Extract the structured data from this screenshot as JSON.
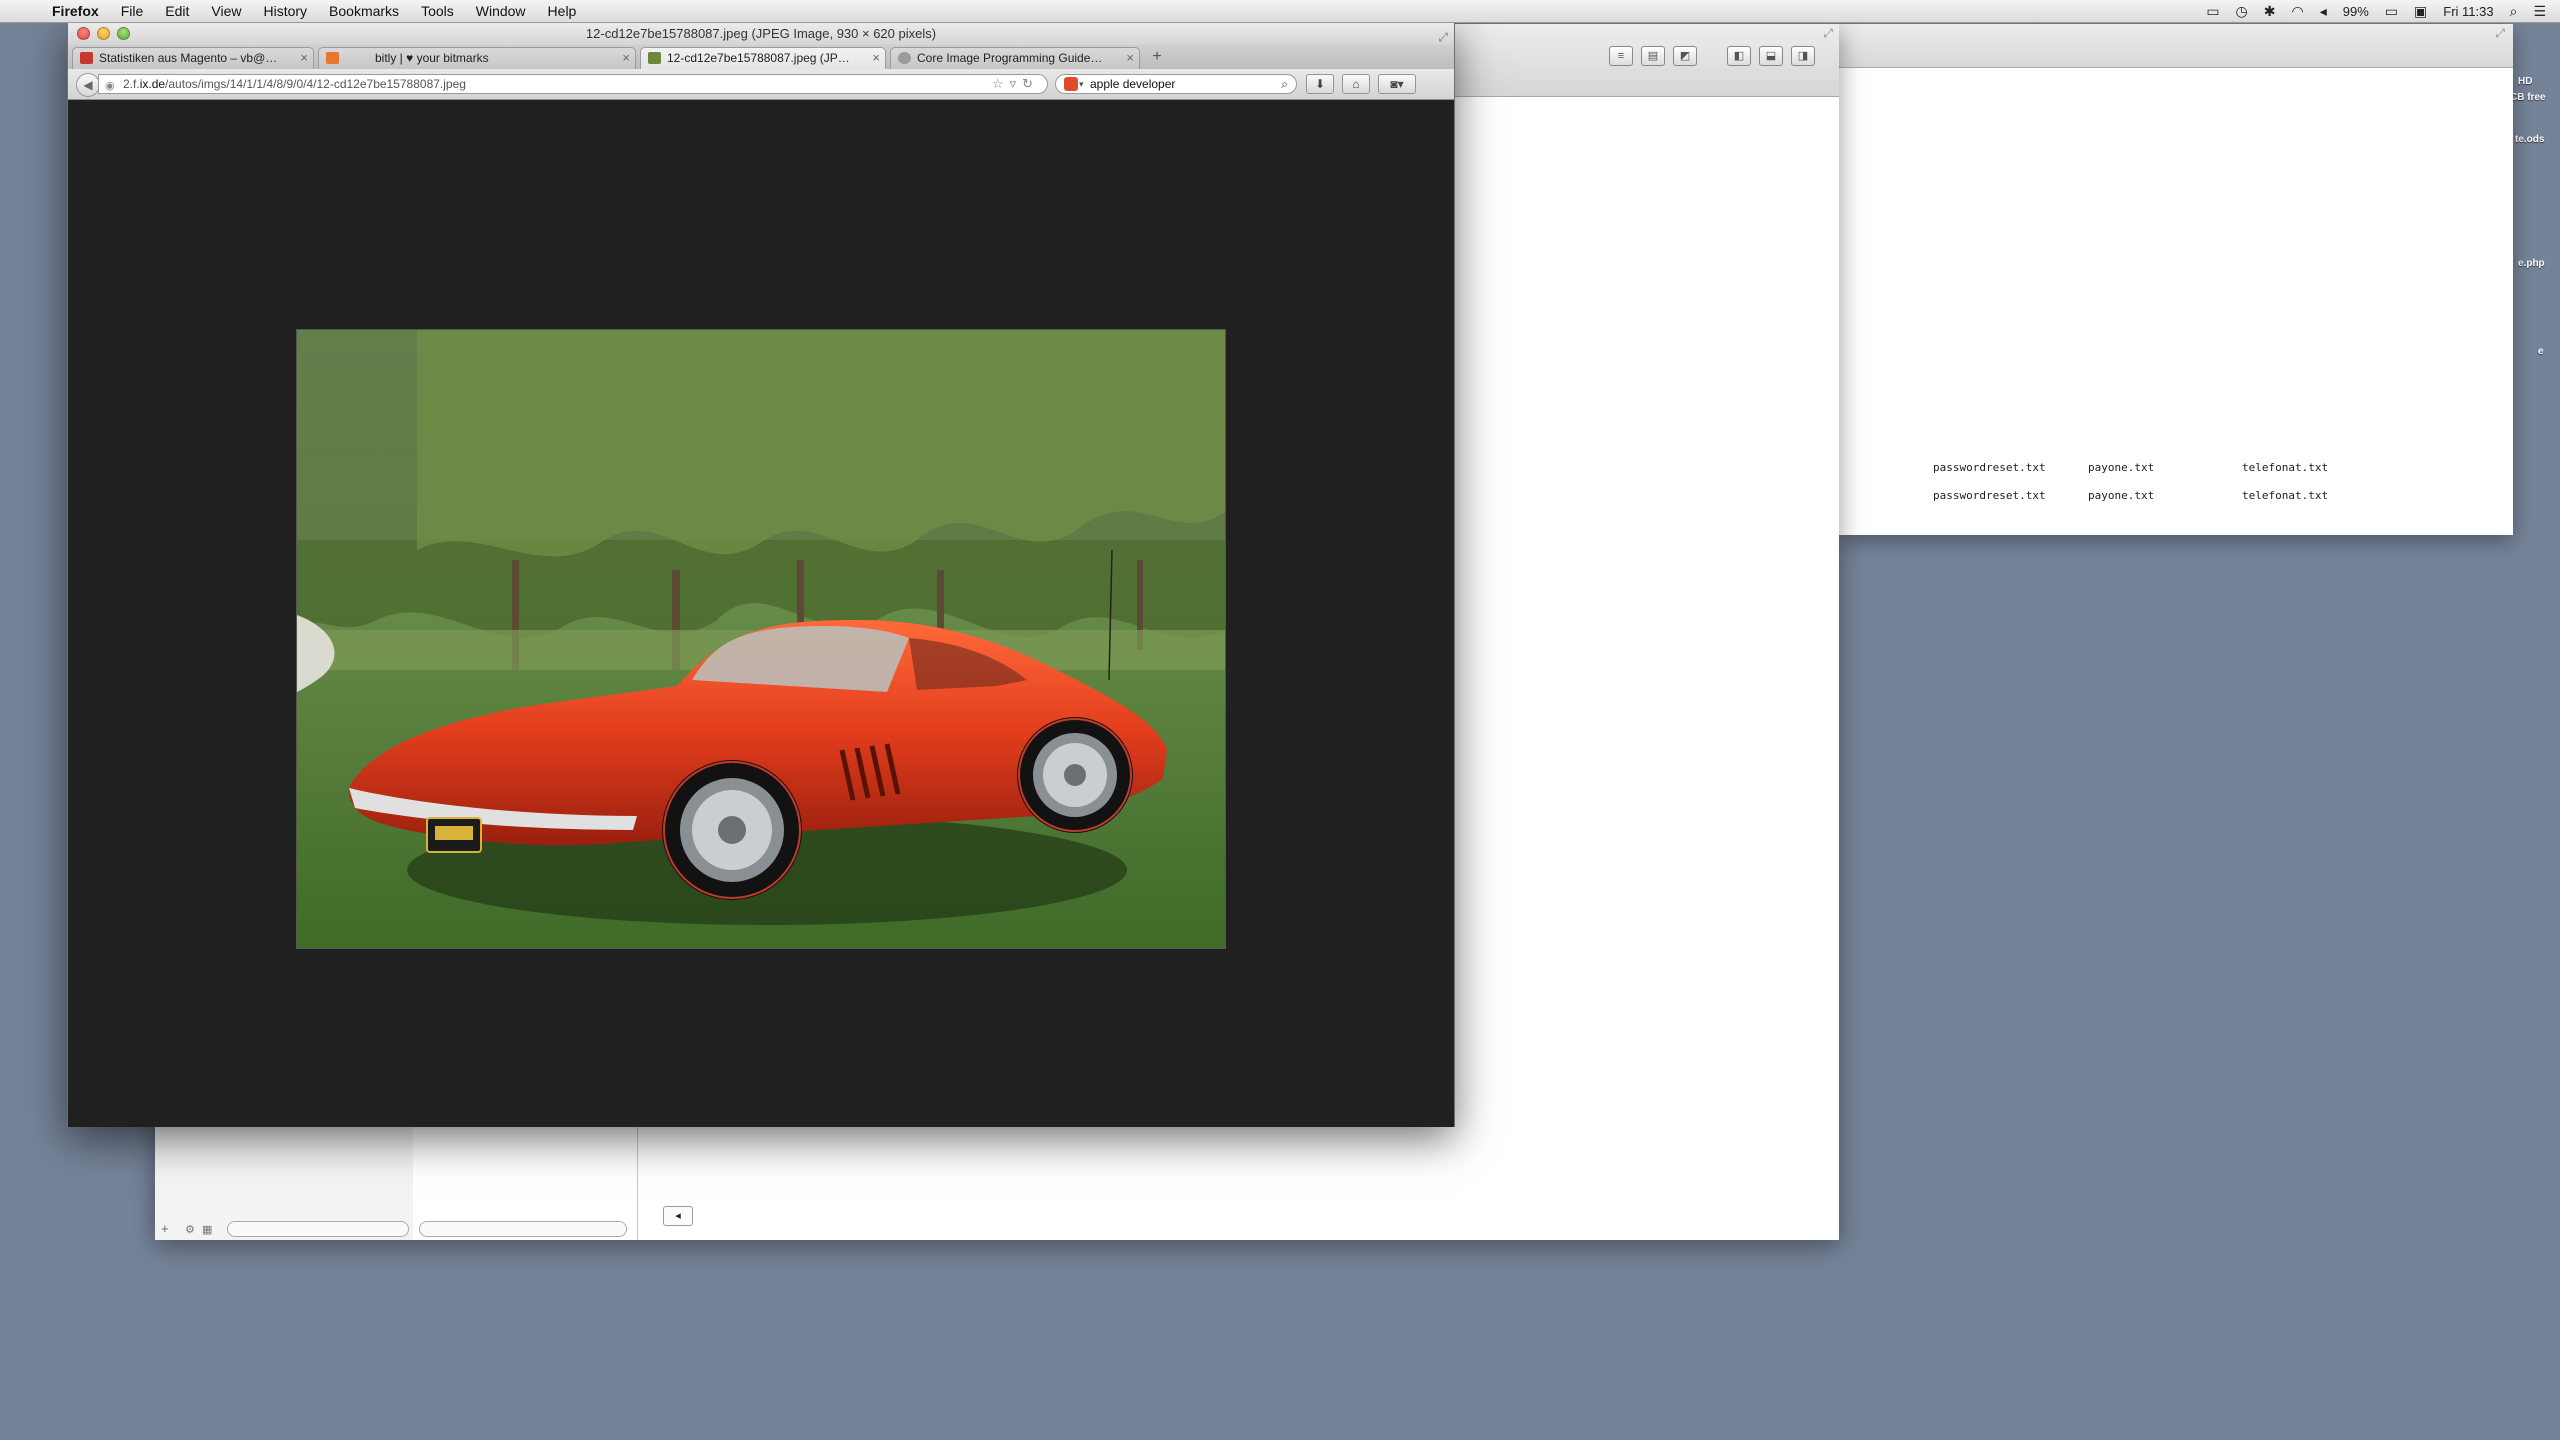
{
  "menubar": {
    "app": "Firefox",
    "items": [
      "File",
      "Edit",
      "View",
      "History",
      "Bookmarks",
      "Tools",
      "Window",
      "Help"
    ],
    "battery": "99%",
    "clock": "Fri 11:33"
  },
  "firefox": {
    "window_title": "12-cd12e7be15788087.jpeg (JPEG Image, 930 × 620 pixels)",
    "tabs": [
      {
        "label": "Statistiken aus Magento – vb@…",
        "favicon_color": "#c8382c"
      },
      {
        "label": "bitly | ♥ your bitmarks",
        "favicon_color": "#e8762d"
      },
      {
        "label": "12-cd12e7be15788087.jpeg (JP…",
        "favicon_color": "#6a8a3a"
      },
      {
        "label": "Core Image Programming Guide…",
        "favicon_color": "#9a9a9a"
      }
    ],
    "url_prefix": "2.f.",
    "url_host": "ix.de",
    "url_path": "/autos/imgs/14/1/1/4/8/9/0/4/12-cd12e7be15788087.jpeg",
    "search_value": "apple developer"
  },
  "right_window": {
    "files_row1": [
      "passwordreset.txt",
      "payone.txt",
      "telefonat.txt"
    ],
    "files_row2": [
      "passwordreset.txt",
      "payone.txt",
      "telefonat.txt"
    ],
    "edge_labels": [
      "HD",
      "CB free",
      "te.ods",
      "e.php",
      "e"
    ]
  }
}
